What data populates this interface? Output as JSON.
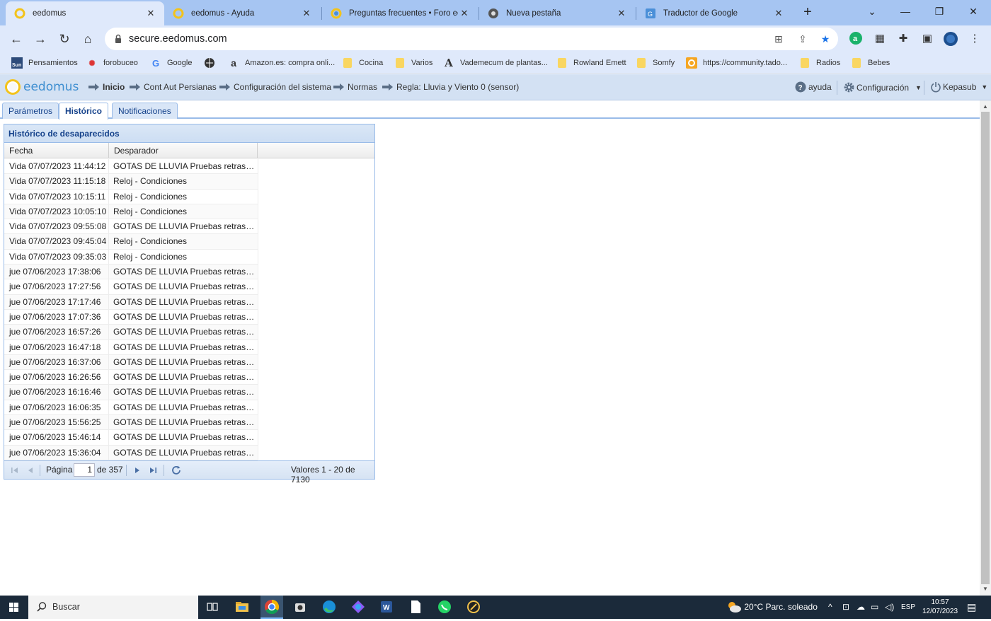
{
  "browser": {
    "tabs": [
      {
        "title": "eedomus",
        "active": true
      },
      {
        "title": "eedomus - Ayuda",
        "active": false
      },
      {
        "title": "Preguntas frecuentes • Foro eedo",
        "active": false
      },
      {
        "title": "Nueva pestaña",
        "active": false
      },
      {
        "title": "Traductor de Google",
        "active": false
      }
    ],
    "url": "secure.eedomus.com",
    "bookmarks": [
      {
        "label": "Pensamientos",
        "icon": "sun-icon"
      },
      {
        "label": "forobuceo",
        "icon": "crab-icon"
      },
      {
        "label": "Google",
        "icon": "google-icon"
      },
      {
        "label": "",
        "icon": "globe-icon"
      },
      {
        "label": "Amazon.es: compra onli...",
        "icon": "amazon-icon"
      },
      {
        "label": "Cocina",
        "icon": "folder-icon"
      },
      {
        "label": "Varios",
        "icon": "folder-icon"
      },
      {
        "label": "Vademecum de plantas...",
        "icon": "letter-a-icon"
      },
      {
        "label": "Rowland Emett",
        "icon": "folder-icon"
      },
      {
        "label": "Somfy",
        "icon": "folder-icon"
      },
      {
        "label": "https://community.tado...",
        "icon": "tado-icon"
      },
      {
        "label": "Radios",
        "icon": "folder-icon"
      },
      {
        "label": "Bebes",
        "icon": "folder-icon"
      }
    ]
  },
  "app": {
    "logo_text": "eedomus",
    "breadcrumb": [
      {
        "label": "Inicio",
        "bold": true
      },
      {
        "label": "Cont Aut Persianas",
        "bold": false
      },
      {
        "label": "Configuración del sistema",
        "bold": false
      },
      {
        "label": "Normas",
        "bold": false
      },
      {
        "label": "Regla: Lluvia y Viento 0 (sensor)",
        "bold": false
      }
    ],
    "help_label": "ayuda",
    "config_label": "Configuración",
    "user_label": "Kepasub"
  },
  "subtabs": [
    {
      "label": "Parámetros",
      "active": false
    },
    {
      "label": "Histórico",
      "active": true
    },
    {
      "label": "Notificaciones",
      "active": false
    }
  ],
  "grid": {
    "title": "Histórico de desaparecidos",
    "columns": [
      "Fecha",
      "Desparador"
    ],
    "rows": [
      [
        "Vida 07/07/2023 11:44:12",
        "GOTAS DE LLUVIA Pruebas retraso..."
      ],
      [
        "Vida 07/07/2023 11:15:18",
        "Reloj - Condiciones"
      ],
      [
        "Vida 07/07/2023 10:15:11",
        "Reloj - Condiciones"
      ],
      [
        "Vida 07/07/2023 10:05:10",
        "Reloj - Condiciones"
      ],
      [
        "Vida 07/07/2023 09:55:08",
        "GOTAS DE LLUVIA Pruebas retraso..."
      ],
      [
        "Vida 07/07/2023 09:45:04",
        "Reloj - Condiciones"
      ],
      [
        "Vida 07/07/2023 09:35:03",
        "Reloj - Condiciones"
      ],
      [
        "jue 07/06/2023 17:38:06",
        "GOTAS DE LLUVIA Pruebas retraso..."
      ],
      [
        "jue 07/06/2023 17:27:56",
        "GOTAS DE LLUVIA Pruebas retraso..."
      ],
      [
        "jue 07/06/2023 17:17:46",
        "GOTAS DE LLUVIA Pruebas retraso..."
      ],
      [
        "jue 07/06/2023 17:07:36",
        "GOTAS DE LLUVIA Pruebas retraso..."
      ],
      [
        "jue 07/06/2023 16:57:26",
        "GOTAS DE LLUVIA Pruebas retraso..."
      ],
      [
        "jue 07/06/2023 16:47:18",
        "GOTAS DE LLUVIA Pruebas retraso..."
      ],
      [
        "jue 07/06/2023 16:37:06",
        "GOTAS DE LLUVIA Pruebas retraso..."
      ],
      [
        "jue 07/06/2023 16:26:56",
        "GOTAS DE LLUVIA Pruebas retraso..."
      ],
      [
        "jue 07/06/2023 16:16:46",
        "GOTAS DE LLUVIA Pruebas retraso..."
      ],
      [
        "jue 07/06/2023 16:06:35",
        "GOTAS DE LLUVIA Pruebas retraso..."
      ],
      [
        "jue 07/06/2023 15:56:25",
        "GOTAS DE LLUVIA Pruebas retraso..."
      ],
      [
        "jue 07/06/2023 15:46:14",
        "GOTAS DE LLUVIA Pruebas retraso..."
      ],
      [
        "jue 07/06/2023 15:36:04",
        "GOTAS DE LLUVIA Pruebas retraso..."
      ]
    ],
    "pager": {
      "page_label": "Página",
      "page_value": "1",
      "of_label": "de 357",
      "summary": "Valores 1 - 20 de 7130"
    }
  },
  "taskbar": {
    "search_placeholder": "Buscar",
    "weather": "20°C  Parc. soleado",
    "language": "ESP",
    "time": "10:57",
    "date": "12/07/2023"
  },
  "colors": {
    "tabstrip": "#a6c5f2",
    "toolbar": "#dfe9fb",
    "app_header": "#d3e1f3",
    "panel_border": "#99bbe8",
    "title_text": "#15428b",
    "taskbar": "#1b2a3a"
  }
}
